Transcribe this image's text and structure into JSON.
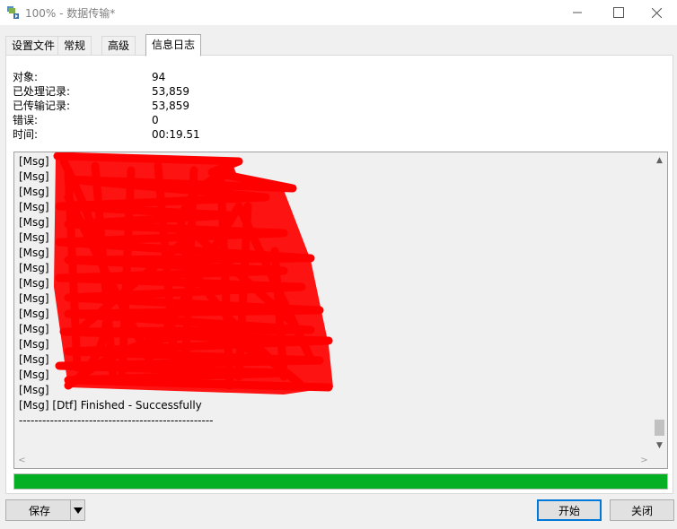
{
  "window": {
    "title": "100% - 数据传输*",
    "app_icon": "data-transfer-icon",
    "minimize_icon": "minimize-icon",
    "maximize_icon": "maximize-icon",
    "close_icon": "close-icon"
  },
  "tabs": [
    {
      "label": "设置文件",
      "active": false
    },
    {
      "label": "常规",
      "active": false
    },
    {
      "label": "高级",
      "active": false
    },
    {
      "label": "信息日志",
      "active": true
    }
  ],
  "stats": {
    "objects_label": "对象:",
    "objects_value": "94",
    "processed_label": "已处理记录:",
    "processed_value": "53,859",
    "transferred_label": "已传输记录:",
    "transferred_value": "53,859",
    "errors_label": "错误:",
    "errors_value": "0",
    "time_label": "时间:",
    "time_value": "00:19.51"
  },
  "log": {
    "lines": [
      "[Msg]",
      "[Msg]",
      "[Msg]",
      "[Msg]",
      "[Msg]",
      "[Msg]",
      "[Msg]",
      "[Msg]",
      "[Msg]",
      "[Msg]",
      "[Msg]",
      "[Msg]",
      "[Msg]",
      "[Msg]",
      "[Msg]",
      "[Msg]",
      "[Msg] [Dtf] Finished - Successfully",
      "--------------------------------------------------"
    ]
  },
  "progress": {
    "percent": 100,
    "color": "#06b025"
  },
  "buttons": {
    "save": "保存",
    "start": "开始",
    "close": "关闭"
  },
  "colors": {
    "redaction": "#ff0000",
    "accent": "#0078d7"
  }
}
